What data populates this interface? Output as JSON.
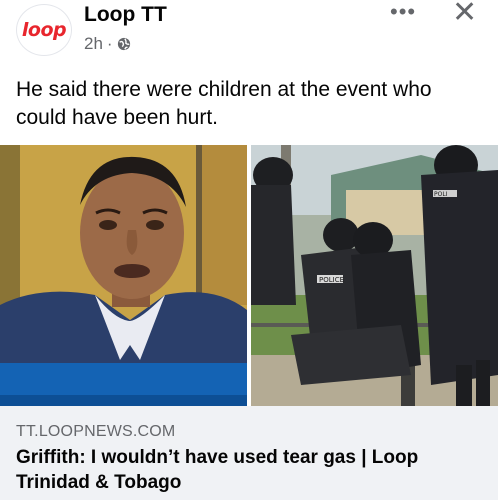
{
  "post": {
    "page_name": "Loop TT",
    "avatar_logo_text": "loop",
    "time": "2h",
    "separator": "·",
    "body_text": "He said there were children at the event who could have been hurt.",
    "icons": {
      "privacy": "globe-icon",
      "more": "more-options-icon",
      "close": "close-icon",
      "info": "info-icon"
    }
  },
  "link_preview": {
    "domain": "TT.LOOPNEWS.COM",
    "title": "Griffith: I wouldn’t have used tear gas | Loop Trinidad & Tobago"
  },
  "images": {
    "right_vest_text": "POLICE",
    "right_vest_text2": "POLI"
  },
  "colors": {
    "brand_red": "#e8262d",
    "secondary_text": "#65676b",
    "link_bg": "#f0f2f5"
  }
}
